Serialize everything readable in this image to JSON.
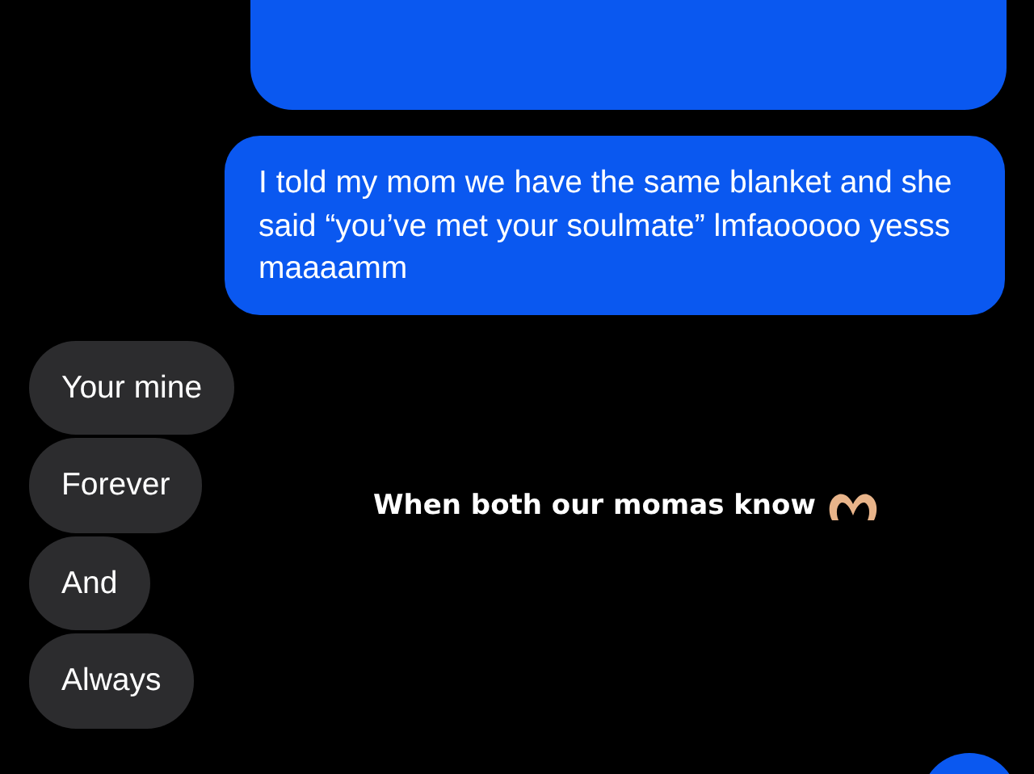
{
  "messages": [
    {
      "kind": "sent",
      "text": "I told my mom we have the same blanket and she said “you’ve met your soulmate” lmfaooooo yesss maaaamm"
    },
    {
      "kind": "received",
      "text": "Your mine"
    },
    {
      "kind": "received",
      "text": "Forever"
    },
    {
      "kind": "received",
      "text": "And"
    },
    {
      "kind": "received",
      "text": "Always"
    }
  ],
  "caption": {
    "text": "When both our momas know"
  }
}
